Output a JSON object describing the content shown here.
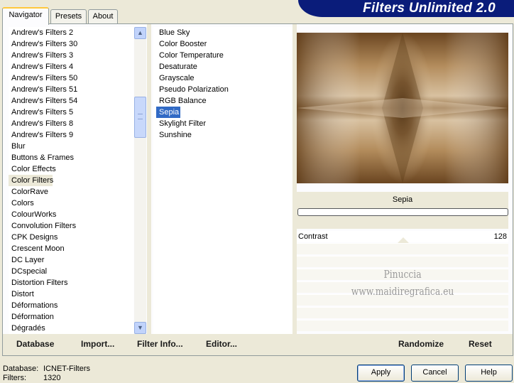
{
  "app": {
    "title": "Filters Unlimited 2.0"
  },
  "tabs": [
    {
      "label": "Navigator",
      "active": true
    },
    {
      "label": "Presets",
      "active": false
    },
    {
      "label": "About",
      "active": false
    }
  ],
  "categories": [
    "Andrew's Filters 2",
    "Andrew's Filters 30",
    "Andrew's Filters 3",
    "Andrew's Filters 4",
    "Andrew's Filters 50",
    "Andrew's Filters 51",
    "Andrew's Filters 54",
    "Andrew's Filters 5",
    "Andrew's Filters 8",
    "Andrew's Filters 9",
    "Blur",
    "Buttons & Frames",
    "Color Effects",
    "Color Filters",
    "ColorRave",
    "Colors",
    "ColourWorks",
    "Convolution Filters",
    "CPK Designs",
    "Crescent Moon",
    "DC Layer",
    "DCspecial",
    "Distortion Filters",
    "Distort",
    "Déformations",
    "Déformation",
    "Dégradés"
  ],
  "selected_category": "Color Filters",
  "filters": [
    "Blue Sky",
    "Color Booster",
    "Color Temperature",
    "Desaturate",
    "Grayscale",
    "Pseudo Polarization",
    "RGB Balance",
    "Sepia",
    "Skylight Filter",
    "Sunshine"
  ],
  "selected_filter": "Sepia",
  "preview": {
    "filter_name": "Sepia",
    "colors": {
      "dark": "#5a3815",
      "mid": "#a57c4c",
      "light": "#dcc5a5"
    }
  },
  "controls": [
    {
      "label": "Contrast",
      "value": 128
    }
  ],
  "watermark": {
    "line1": "Pinuccia",
    "line2": "www.maidiregrafica.eu"
  },
  "bottom_links": {
    "database": "Database",
    "import": "Import...",
    "filter_info": "Filter Info...",
    "editor": "Editor...",
    "randomize": "Randomize",
    "reset": "Reset"
  },
  "footer": {
    "database_label": "Database:",
    "database_value": "ICNET-Filters",
    "filters_label": "Filters:",
    "filters_value": "1320"
  },
  "buttons": {
    "apply": "Apply",
    "cancel": "Cancel",
    "help": "Help"
  },
  "icons": {
    "scroll_up": "chevron-up-icon",
    "scroll_down": "chevron-down-icon"
  }
}
